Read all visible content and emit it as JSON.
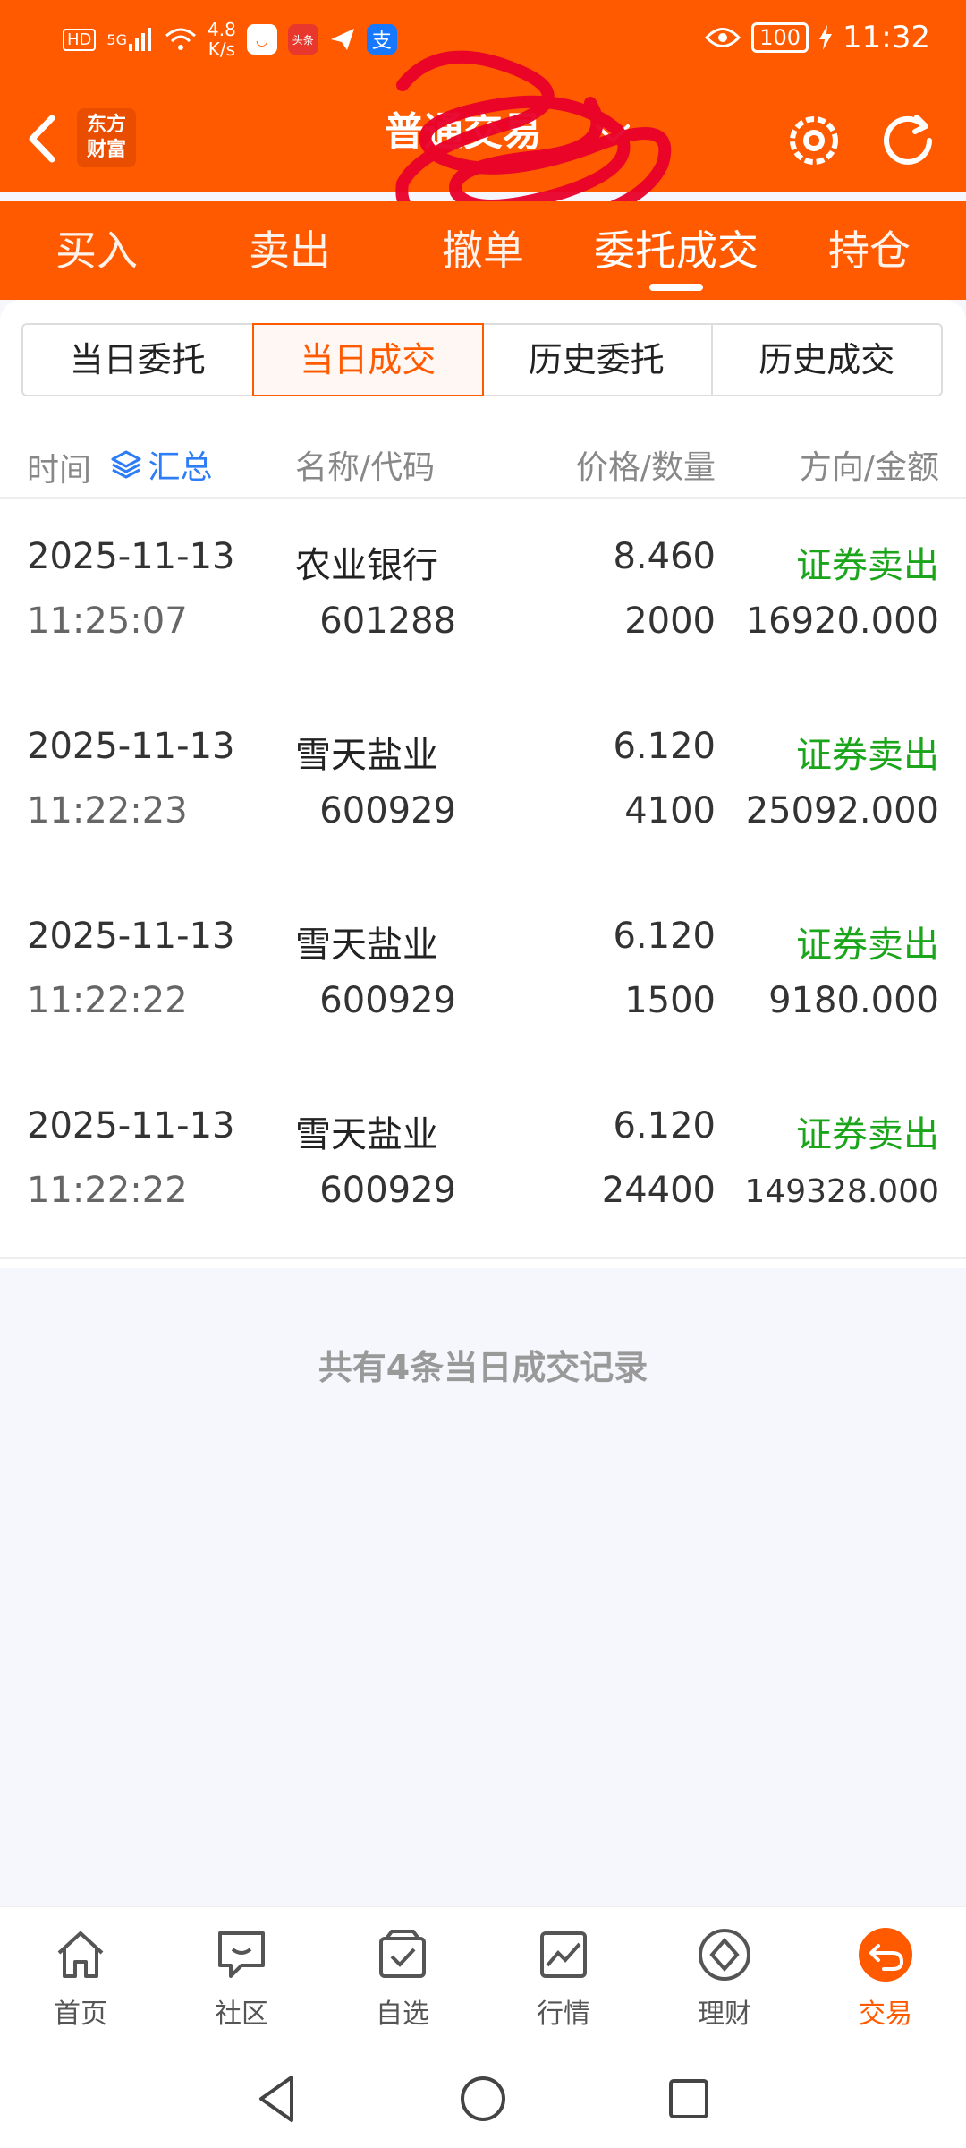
{
  "status_bar": {
    "hd": "HD",
    "net_type": "5G",
    "net_speed_value": "4.8",
    "net_speed_unit": "K/s",
    "app_badge_toutiao": "头条",
    "battery": "100",
    "time": "11:32"
  },
  "header": {
    "logo_line1": "东方",
    "logo_line2": "财富",
    "account_title": "普通交易"
  },
  "main_tabs": [
    {
      "label": "买入"
    },
    {
      "label": "卖出"
    },
    {
      "label": "撤单"
    },
    {
      "label": "委托成交",
      "active": true
    },
    {
      "label": "持仓"
    }
  ],
  "sub_tabs": [
    {
      "label": "当日委托"
    },
    {
      "label": "当日成交",
      "active": true
    },
    {
      "label": "历史委托"
    },
    {
      "label": "历史成交"
    }
  ],
  "table": {
    "col_time": "时间",
    "summary_label": "汇总",
    "col_name_code": "名称/代码",
    "col_price_qty": "价格/数量",
    "col_dir_amount": "方向/金额",
    "rows": [
      {
        "date": "2025-11-13",
        "time": "11:25:07",
        "name": "农业银行",
        "code": "601288",
        "price": "8.460",
        "qty": "2000",
        "direction": "证券卖出",
        "amount": "16920.000"
      },
      {
        "date": "2025-11-13",
        "time": "11:22:23",
        "name": "雪天盐业",
        "code": "600929",
        "price": "6.120",
        "qty": "4100",
        "direction": "证券卖出",
        "amount": "25092.000"
      },
      {
        "date": "2025-11-13",
        "time": "11:22:22",
        "name": "雪天盐业",
        "code": "600929",
        "price": "6.120",
        "qty": "1500",
        "direction": "证券卖出",
        "amount": "9180.000"
      },
      {
        "date": "2025-11-13",
        "time": "11:22:22",
        "name": "雪天盐业",
        "code": "600929",
        "price": "6.120",
        "qty": "24400",
        "direction": "证券卖出",
        "amount": "149328.000"
      }
    ]
  },
  "record_count": "共有4条当日成交记录",
  "bottom_nav": [
    {
      "label": "首页",
      "icon": "home-icon"
    },
    {
      "label": "社区",
      "icon": "chat-icon"
    },
    {
      "label": "自选",
      "icon": "watchlist-icon"
    },
    {
      "label": "行情",
      "icon": "chart-icon"
    },
    {
      "label": "理财",
      "icon": "diamond-icon"
    },
    {
      "label": "交易",
      "icon": "trade-icon",
      "active": true
    }
  ],
  "colors": {
    "brand": "#ff5a00",
    "sell_green": "#1aa51a",
    "link_blue": "#2e7cf6"
  }
}
